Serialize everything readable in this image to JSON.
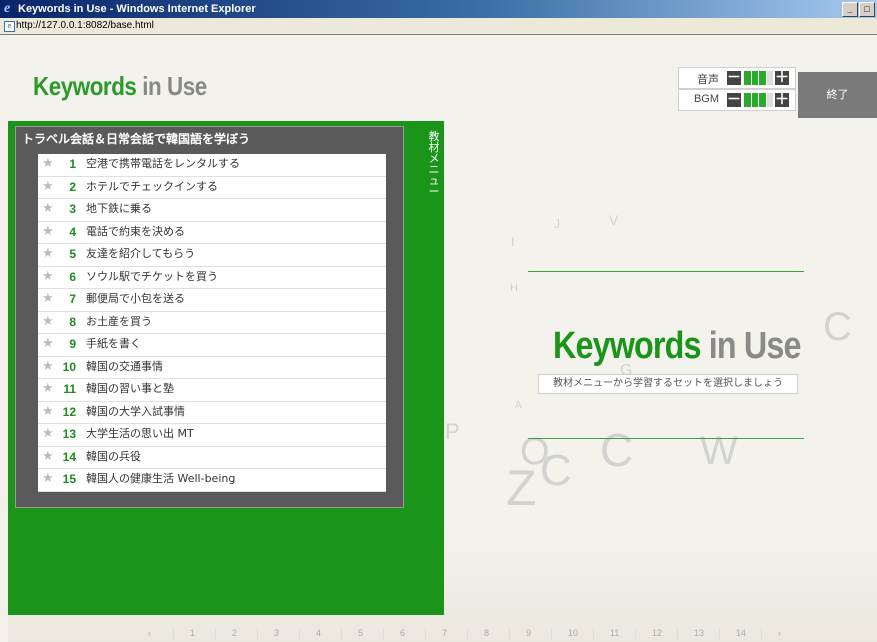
{
  "window": {
    "title": "Keywords in Use - Windows Internet Explorer",
    "controls": [
      "_",
      "□",
      "×"
    ]
  },
  "address": {
    "url": "http://127.0.0.1:8082/base.html"
  },
  "header": {
    "logo_main": "Keywords",
    "logo_in": "in",
    "logo_use": "Use",
    "volume_label": "音声",
    "bgm_label": "BGM",
    "minus": "－",
    "plus": "＋",
    "exit_label": "終了",
    "volume_level": 3,
    "bgm_level": 3,
    "level_max": 4
  },
  "menu": {
    "title": "トラベル会話＆日常会話で韓国語を学ぼう",
    "side_tab": "教材メニュー",
    "items": [
      {
        "num": "1",
        "label": "空港で携帯電話をレンタルする"
      },
      {
        "num": "2",
        "label": "ホテルでチェックインする"
      },
      {
        "num": "3",
        "label": "地下鉄に乗る"
      },
      {
        "num": "4",
        "label": "電話で約束を決める"
      },
      {
        "num": "5",
        "label": "友達を紹介してもらう"
      },
      {
        "num": "6",
        "label": "ソウル駅でチケットを買う"
      },
      {
        "num": "7",
        "label": "郵便局で小包を送る"
      },
      {
        "num": "8",
        "label": "お土産を買う"
      },
      {
        "num": "9",
        "label": "手紙を書く"
      },
      {
        "num": "10",
        "label": "韓国の交通事情"
      },
      {
        "num": "11",
        "label": "韓国の習い事と塾"
      },
      {
        "num": "12",
        "label": "韓国の大学入試事情"
      },
      {
        "num": "13",
        "label": "大学生活の思い出 MT"
      },
      {
        "num": "14",
        "label": "韓国の兵役"
      },
      {
        "num": "15",
        "label": "韓国人の健康生活 Well-being"
      }
    ],
    "star": "★"
  },
  "main": {
    "logo_main": "Keywords",
    "logo_in": "in",
    "logo_use": "Use",
    "prompt": "教材メニューから学習するセットを選択しましょう",
    "deco_letters": [
      "J",
      "V",
      "I",
      "H",
      "C",
      "G",
      "A",
      "P",
      "O",
      "W",
      "Z",
      "C",
      "C"
    ]
  },
  "footer_nav": [
    "‹",
    "1",
    "2",
    "3",
    "4",
    "5",
    "6",
    "7",
    "8",
    "9",
    "10",
    "11",
    "12",
    "13",
    "14",
    "›"
  ]
}
